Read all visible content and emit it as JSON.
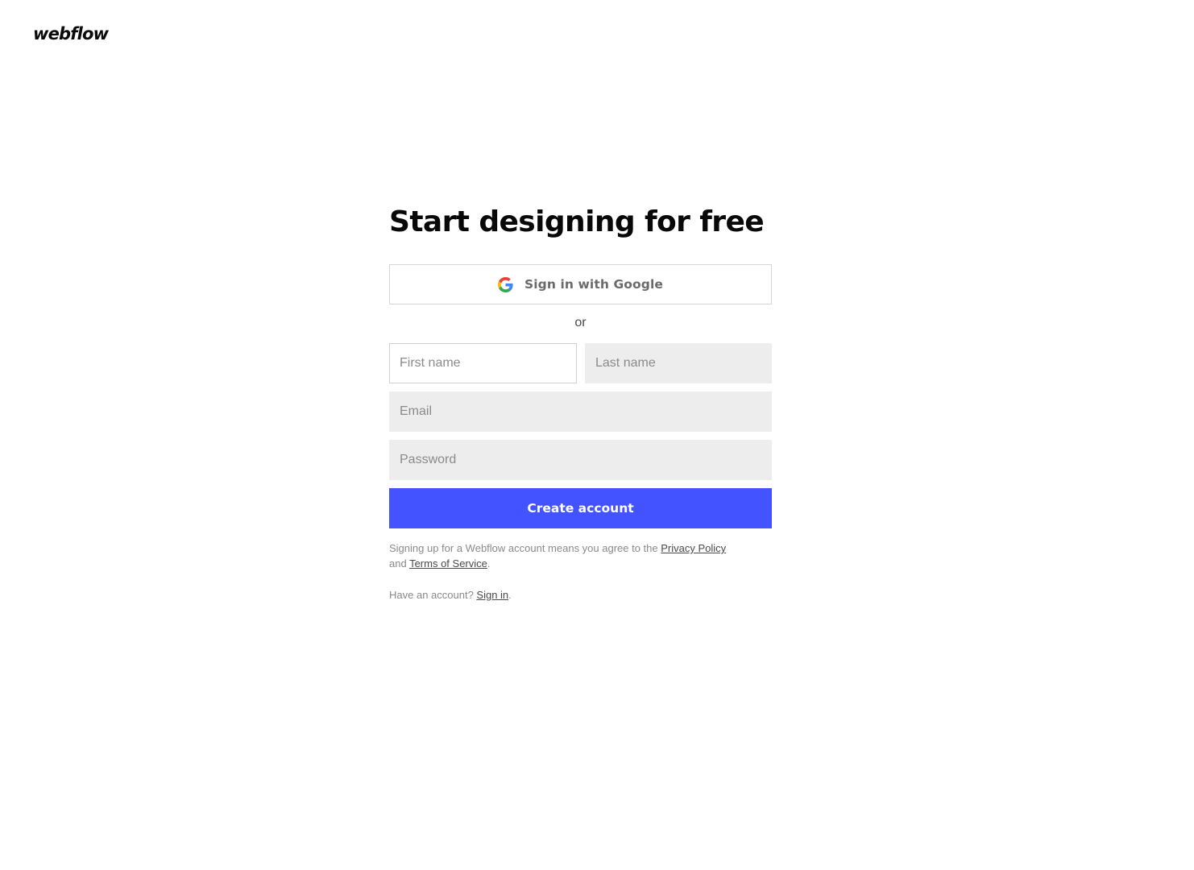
{
  "brand": {
    "logo_text": "webflow"
  },
  "signup": {
    "headline": "Start designing for free",
    "google_button_label": "Sign in with Google",
    "divider_text": "or",
    "first_name_placeholder": "First name",
    "last_name_placeholder": "Last name",
    "email_placeholder": "Email",
    "password_placeholder": "Password",
    "submit_label": "Create account",
    "accent_color": "#4353ff"
  },
  "legal": {
    "prefix": "Signing up for a Webflow account means you agree to the ",
    "privacy_link": "Privacy Policy",
    "middle": "and ",
    "terms_link": "Terms of Service",
    "suffix": "."
  },
  "signin": {
    "prefix": "Have an account? ",
    "link": "Sign in",
    "suffix": "."
  }
}
